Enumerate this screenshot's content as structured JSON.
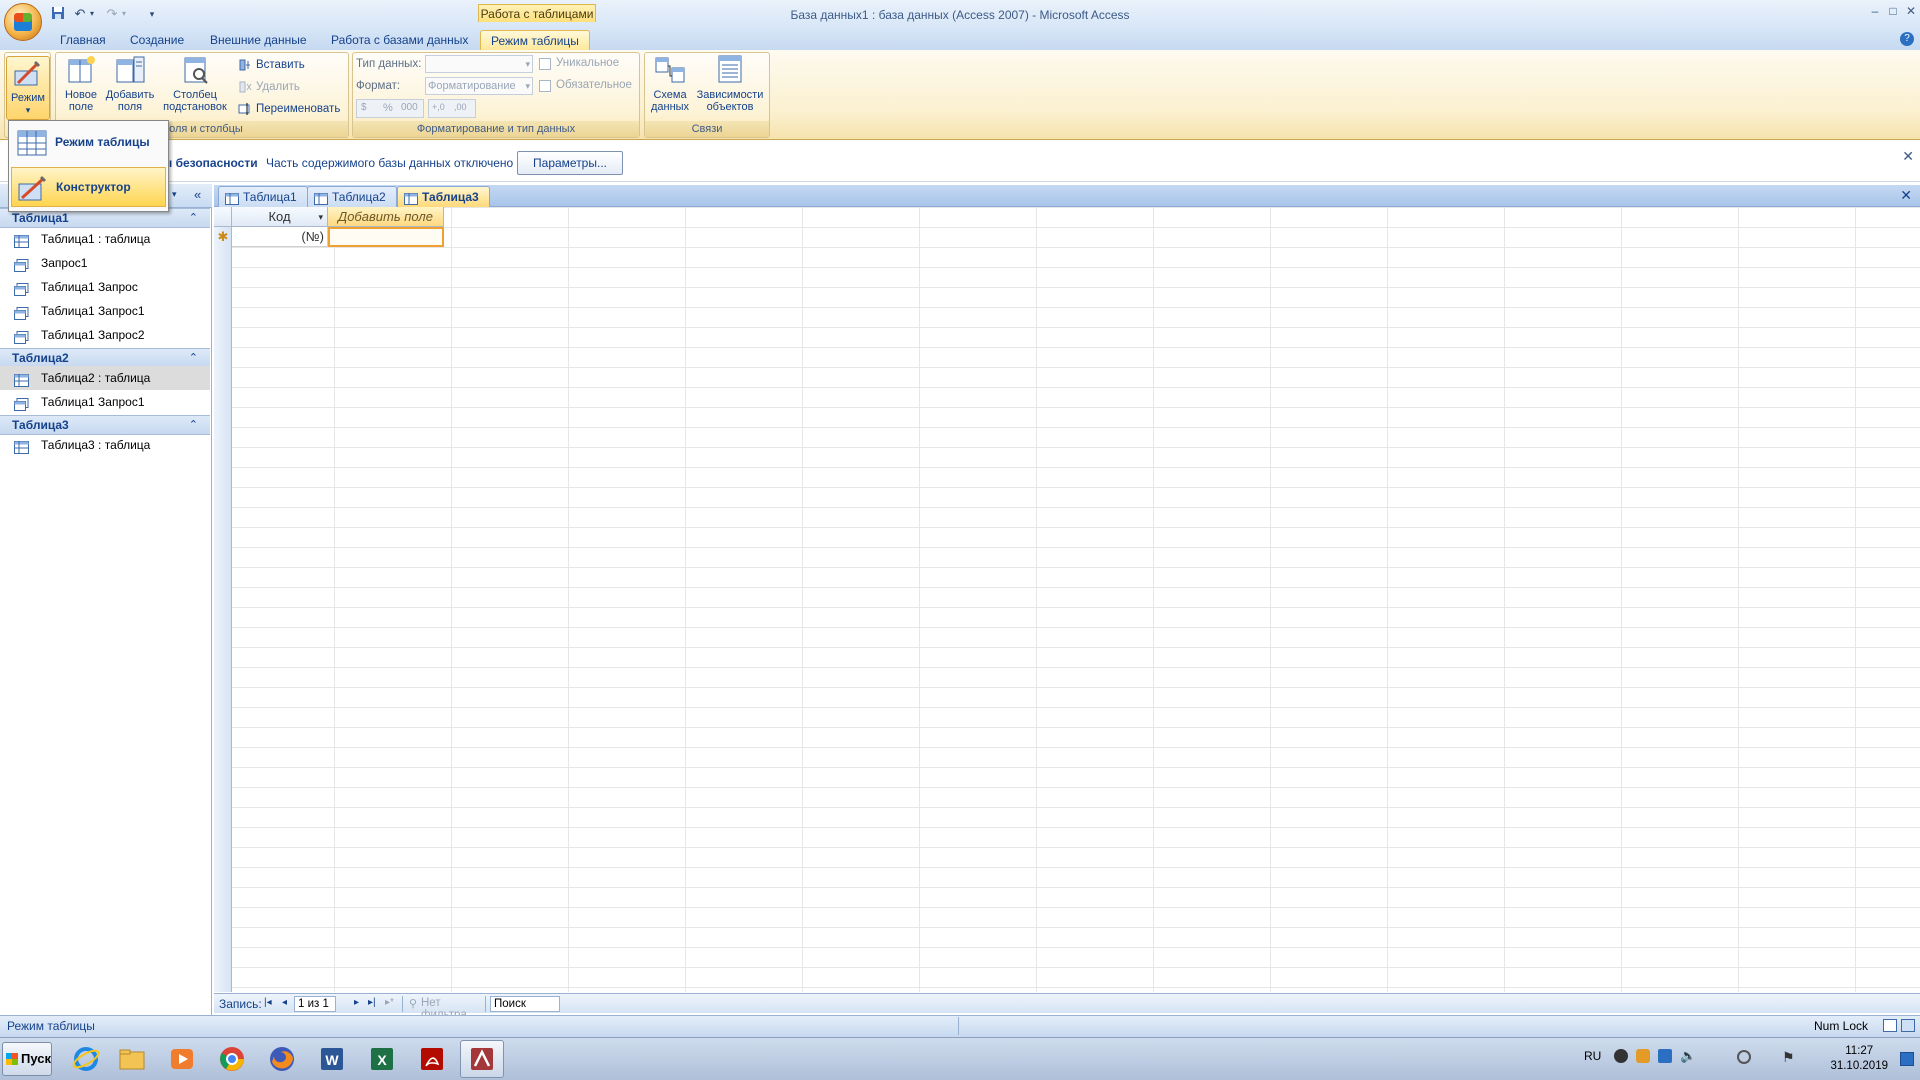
{
  "window": {
    "title": "База данных1 : база данных (Access 2007) - Microsoft Access",
    "contextual_group": "Работа с таблицами",
    "controls": [
      "–",
      "□",
      "✕"
    ]
  },
  "quick_access": {
    "save_icon": "save-icon",
    "undo_icon": "undo-icon",
    "redo_icon": "redo-icon",
    "customize": "▾"
  },
  "tabs": [
    {
      "label": "Главная"
    },
    {
      "label": "Создание"
    },
    {
      "label": "Внешние данные"
    },
    {
      "label": "Работа с базами данных"
    },
    {
      "label": "Режим таблицы"
    }
  ],
  "ribbon": {
    "views": {
      "label": "Режим",
      "arrow": "▾"
    },
    "fields_group": {
      "label": "Поля и столбцы",
      "new_field": [
        "Новое",
        "поле"
      ],
      "add_fields": [
        "Добавить",
        "поля"
      ],
      "lookup_col": [
        "Столбец",
        "подстановок"
      ],
      "insert": "Вставить",
      "delete": "Удалить",
      "rename": "Переименовать"
    },
    "format_group": {
      "label": "Форматирование и тип данных",
      "data_type_label": "Тип данных:",
      "data_type_value": "",
      "format_label": "Формат:",
      "format_value": "Форматирование",
      "unique": "Уникальное",
      "required": "Обязательное",
      "percent": "%",
      "thousands": "000",
      "inc_dec": "+,0",
      "dec_dec": ",00"
    },
    "relations_group": {
      "label": "Связи",
      "schema": [
        "Схема",
        "данных"
      ],
      "deps": [
        "Зависимости",
        "объектов"
      ]
    }
  },
  "mode_menu": {
    "items": [
      {
        "label": "Режим таблицы",
        "highlighted": false
      },
      {
        "label": "Конструктор",
        "highlighted": true
      }
    ]
  },
  "message_bar": {
    "prefix": "ы безопасности",
    "text": "Часть содержимого базы данных отключено",
    "button": "Параметры...",
    "close": "✕"
  },
  "navigation": {
    "collapse_btn": "«",
    "menu_btn": "▾",
    "groups": [
      {
        "name": "Таблица1",
        "toggle": "⌃",
        "items": [
          {
            "label": "Таблица1 : таблица",
            "icon": "table-icon"
          },
          {
            "label": "Запрос1",
            "icon": "query-icon"
          },
          {
            "label": "Таблица1 Запрос",
            "icon": "query-icon"
          },
          {
            "label": "Таблица1 Запрос1",
            "icon": "query-icon"
          },
          {
            "label": "Таблица1 Запрос2",
            "icon": "query-icon"
          }
        ]
      },
      {
        "name": "Таблица2",
        "toggle": "⌃",
        "items": [
          {
            "label": "Таблица2 : таблица",
            "icon": "table-icon",
            "selected": true
          },
          {
            "label": "Таблица1 Запрос1",
            "icon": "query-icon"
          }
        ]
      },
      {
        "name": "Таблица3",
        "toggle": "⌃",
        "items": [
          {
            "label": "Таблица3 : таблица",
            "icon": "table-icon"
          }
        ]
      }
    ]
  },
  "doc_tabs": [
    {
      "label": "Таблица1",
      "active": false
    },
    {
      "label": "Таблица2",
      "active": false
    },
    {
      "label": "Таблица3",
      "active": true
    }
  ],
  "doc_close": "✕",
  "datasheet": {
    "columns": [
      {
        "header": "Код",
        "sort_arrow": "▾"
      },
      {
        "header": "Добавить поле"
      }
    ],
    "new_row_marker": "✱",
    "new_row_values": [
      "(№)",
      ""
    ]
  },
  "record_nav": {
    "label": "Запись:",
    "first": "|◂",
    "prev": "◂",
    "position": "1 из 1",
    "next": "▸",
    "last": "▸|",
    "new": "▸*",
    "filter": "Нет фильтра",
    "search": "Поиск"
  },
  "status": {
    "left": "Режим таблицы",
    "numlock": "Num Lock"
  },
  "taskbar": {
    "start": "Пуск",
    "apps": [
      "ie-icon",
      "explorer-icon",
      "media-player-icon",
      "chrome-icon",
      "firefox-icon",
      "word-icon",
      "excel-icon",
      "acrobat-icon",
      "access-icon"
    ],
    "lang": "RU",
    "time": "11:27",
    "date": "31.10.2019"
  }
}
